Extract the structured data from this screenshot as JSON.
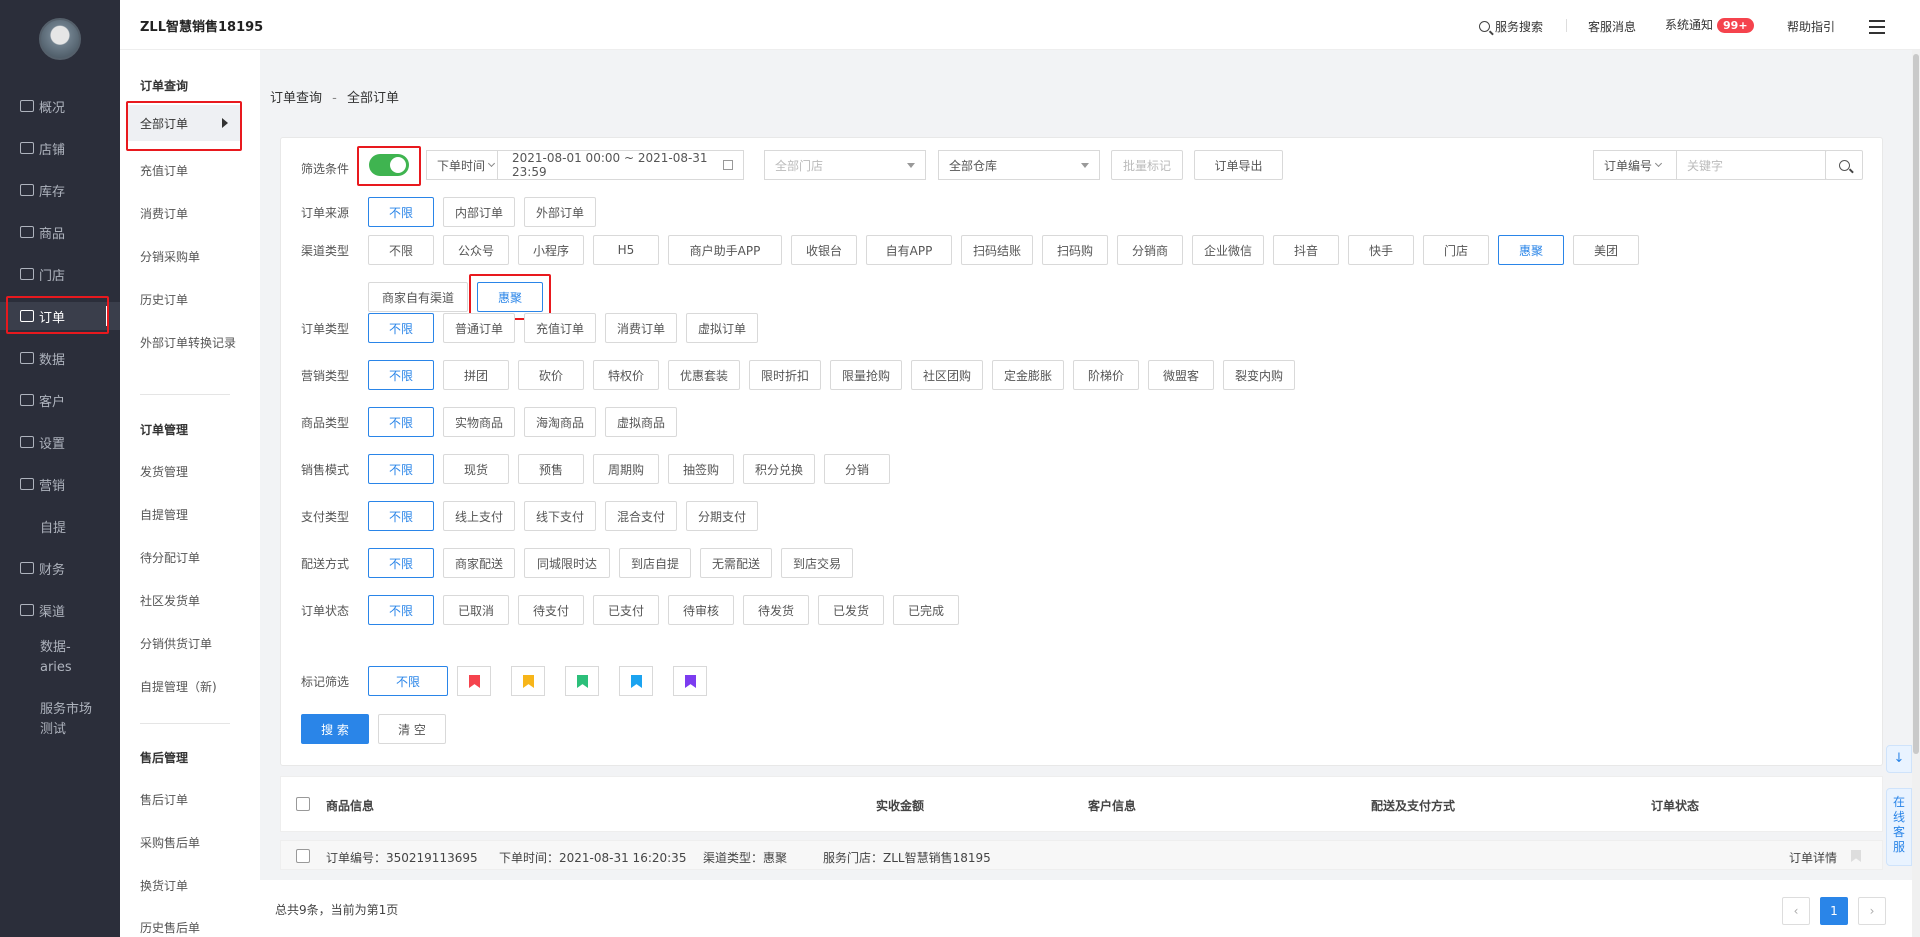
{
  "topbar": {
    "brand": "ZLL智慧销售18195",
    "service_search": "服务搜索",
    "support_msg": "客服消息",
    "system_notice": "系统通知",
    "notice_badge": "99+",
    "help": "帮助指引"
  },
  "nav": [
    {
      "label": "概况",
      "icon": "dashboard-icon"
    },
    {
      "label": "店铺",
      "icon": "store-icon"
    },
    {
      "label": "库存",
      "icon": "inventory-icon"
    },
    {
      "label": "商品",
      "icon": "goods-icon"
    },
    {
      "label": "门店",
      "icon": "shop-icon"
    },
    {
      "label": "订单",
      "icon": "order-icon"
    },
    {
      "label": "数据",
      "icon": "chart-icon"
    },
    {
      "label": "客户",
      "icon": "customer-icon"
    },
    {
      "label": "设置",
      "icon": "gear-icon"
    },
    {
      "label": "营销",
      "icon": "marketing-icon"
    },
    {
      "label": "自提",
      "icon": ""
    },
    {
      "label": "财务",
      "icon": "finance-icon"
    },
    {
      "label": "渠道",
      "icon": "channel-icon"
    },
    {
      "label": "数据-aries",
      "icon": ""
    },
    {
      "label": "服务市场测试",
      "icon": ""
    }
  ],
  "subnav": {
    "order_query": "订单查询",
    "all_orders": "全部订单",
    "recharge_orders": "充值订单",
    "consume_orders": "消费订单",
    "dist_purchase": "分销采购单",
    "history_orders": "历史订单",
    "external_convert": "外部订单转换记录",
    "order_manage": "订单管理",
    "ship_manage": "发货管理",
    "pickup_manage": "自提管理",
    "to_assign": "待分配订单",
    "community_ship": "社区发货单",
    "dist_supply": "分销供货订单",
    "pickup_new": "自提管理（新)",
    "after_sale": "售后管理",
    "after_sale_orders": "售后订单",
    "purchase_after": "采购售后单",
    "exchange": "换货订单",
    "history_after": "历史售后单"
  },
  "breadcrumb": {
    "parent": "订单查询",
    "sep": "-",
    "current": "全部订单"
  },
  "filters": {
    "toggle_label": "筛选条件",
    "time_type": "下单时间",
    "date_range": "2021-08-01 00:00 ~ 2021-08-31 23:59",
    "store_placeholder": "全部门店",
    "warehouse": "全部仓库",
    "batch_mark": "批量标记",
    "export": "订单导出",
    "keyword_type": "订单编号",
    "keyword_placeholder": "关键字",
    "rows": [
      {
        "label": "订单来源",
        "options": [
          "不限",
          "内部订单",
          "外部订单"
        ],
        "selected": 0
      },
      {
        "label": "渠道类型",
        "options": [
          "不限",
          "公众号",
          "小程序",
          "H5",
          "商户助手APP",
          "收银台",
          "自有APP",
          "扫码结账",
          "扫码购",
          "分销商",
          "企业微信",
          "抖音",
          "快手",
          "门店",
          "惠聚",
          "美团",
          "商家自有渠道",
          "惠聚"
        ],
        "selected": 14
      },
      {
        "label": "订单类型",
        "options": [
          "不限",
          "普通订单",
          "充值订单",
          "消费订单",
          "虚拟订单"
        ],
        "selected": 0
      },
      {
        "label": "营销类型",
        "options": [
          "不限",
          "拼团",
          "砍价",
          "特权价",
          "优惠套装",
          "限时折扣",
          "限量抢购",
          "社区团购",
          "定金膨胀",
          "阶梯价",
          "微盟客",
          "裂变内购"
        ],
        "selected": 0
      },
      {
        "label": "商品类型",
        "options": [
          "不限",
          "实物商品",
          "海淘商品",
          "虚拟商品"
        ],
        "selected": 0
      },
      {
        "label": "销售模式",
        "options": [
          "不限",
          "现货",
          "预售",
          "周期购",
          "抽签购",
          "积分兑换",
          "分销"
        ],
        "selected": 0
      },
      {
        "label": "支付类型",
        "options": [
          "不限",
          "线上支付",
          "线下支付",
          "混合支付",
          "分期支付"
        ],
        "selected": 0
      },
      {
        "label": "配送方式",
        "options": [
          "不限",
          "商家配送",
          "同城限时达",
          "到店自提",
          "无需配送",
          "到店交易"
        ],
        "selected": 0
      },
      {
        "label": "订单状态",
        "options": [
          "不限",
          "已取消",
          "待支付",
          "已支付",
          "待审核",
          "待发货",
          "已发货",
          "已完成"
        ],
        "selected": 0
      }
    ],
    "mark_label": "标记筛选",
    "mark_any": "不限",
    "flag_colors": [
      "#f5434d",
      "#f7b519",
      "#2cbf7a",
      "#1ba3f0",
      "#7c3cf0"
    ],
    "search_btn": "搜 索",
    "clear_btn": "清 空"
  },
  "table": {
    "headers": [
      "商品信息",
      "实收金额",
      "客户信息",
      "配送及支付方式",
      "订单状态"
    ]
  },
  "order": {
    "no": "订单编号：350219113695",
    "time": "下单时间：2021-08-31 16:20:35",
    "channel": "渠道类型：惠聚",
    "store": "服务门店：ZLL智慧销售18195",
    "detail": "订单详情"
  },
  "footer": {
    "summary": "总共9条，当前为第1页",
    "page": "1"
  },
  "sidetools": {
    "online_service": "在线客服"
  },
  "colors": {
    "primary": "#2a85e8",
    "highlight": "#e8191e",
    "toggle_on": "#3fb450"
  }
}
